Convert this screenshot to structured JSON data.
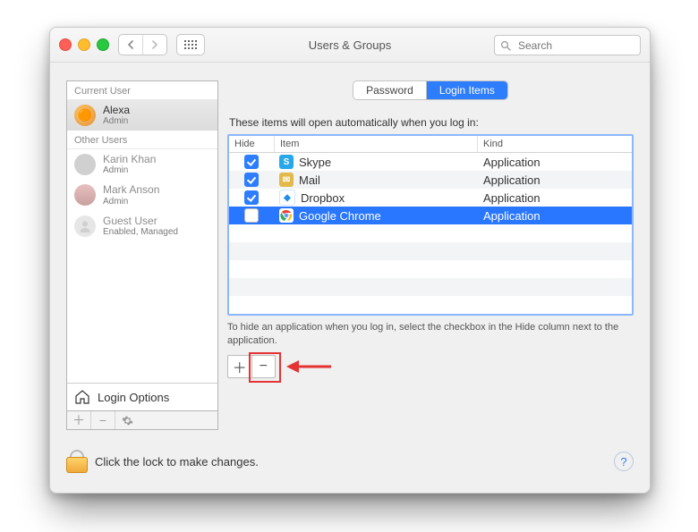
{
  "window": {
    "title": "Users & Groups",
    "search_placeholder": "Search"
  },
  "sidebar": {
    "sections": [
      {
        "title": "Current User",
        "users": [
          {
            "name": "Alexa",
            "role": "Admin",
            "selected": true
          }
        ]
      },
      {
        "title": "Other Users",
        "users": [
          {
            "name": "Karin Khan",
            "role": "Admin"
          },
          {
            "name": "Mark Anson",
            "role": "Admin"
          },
          {
            "name": "Guest User",
            "role": "Enabled, Managed"
          }
        ]
      }
    ],
    "login_options_label": "Login Options"
  },
  "main": {
    "tabs": [
      {
        "label": "Password",
        "selected": false
      },
      {
        "label": "Login Items",
        "selected": true
      }
    ],
    "caption": "These items will open automatically when you log in:",
    "columns": [
      "Hide",
      "Item",
      "Kind"
    ],
    "rows": [
      {
        "hide": true,
        "item": "Skype",
        "kind": "Application",
        "selected": false
      },
      {
        "hide": true,
        "item": "Mail",
        "kind": "Application",
        "selected": false
      },
      {
        "hide": true,
        "item": "Dropbox",
        "kind": "Application",
        "selected": false
      },
      {
        "hide": false,
        "item": "Google Chrome",
        "kind": "Application",
        "selected": true
      }
    ],
    "hint": "To hide an application when you log in, select the checkbox in the Hide column next to the application."
  },
  "footer": {
    "lock_text": "Click the lock to make changes."
  }
}
